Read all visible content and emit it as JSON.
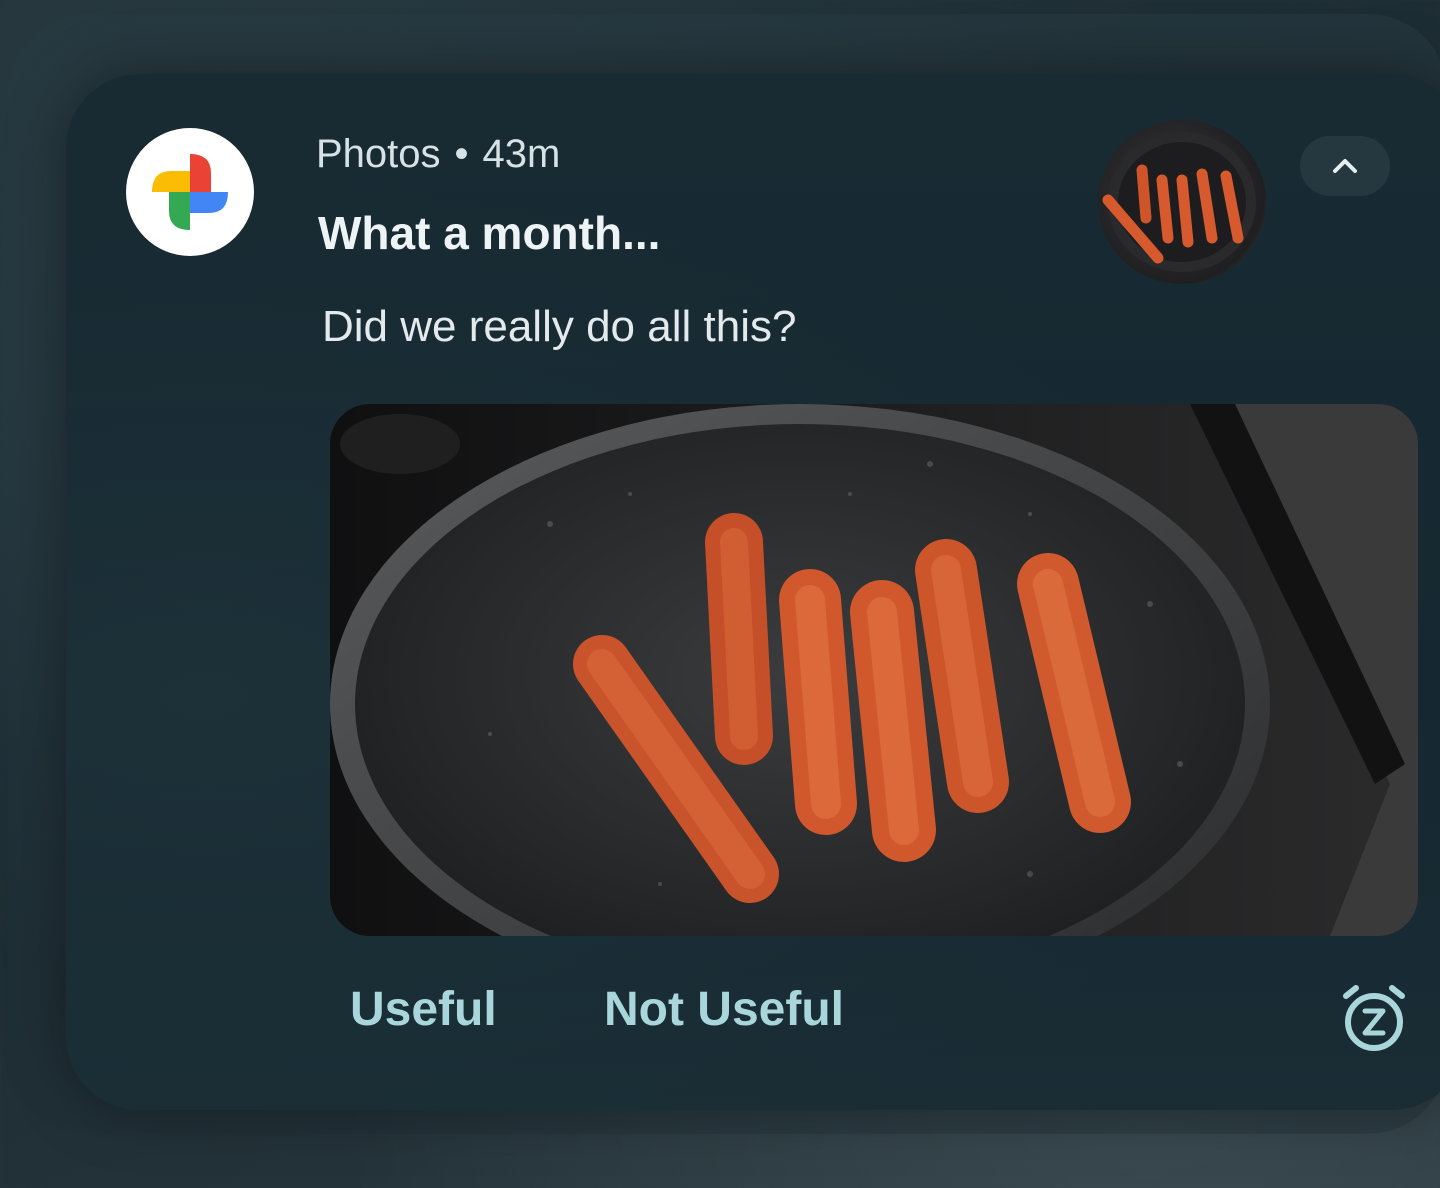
{
  "notification": {
    "app_name": "Photos",
    "separator": "•",
    "time_ago": "43m",
    "title": "What a month...",
    "body": "Did we really do all this?",
    "app_icon": "google-photos-pinwheel-icon",
    "collapse_icon": "chevron-up-icon",
    "large_image": "photo of six sausages cooking in a black frying pan",
    "thumbnail": "circular thumbnail of sausages in a pan"
  },
  "actions": {
    "useful_label": "Useful",
    "not_useful_label": "Not Useful",
    "snooze_icon": "snooze-alarm-icon"
  },
  "colors": {
    "card_background": "#16282f",
    "action_text": "#a9d6da",
    "title_text": "#eef3f5",
    "meta_text": "#d7e2e6"
  }
}
